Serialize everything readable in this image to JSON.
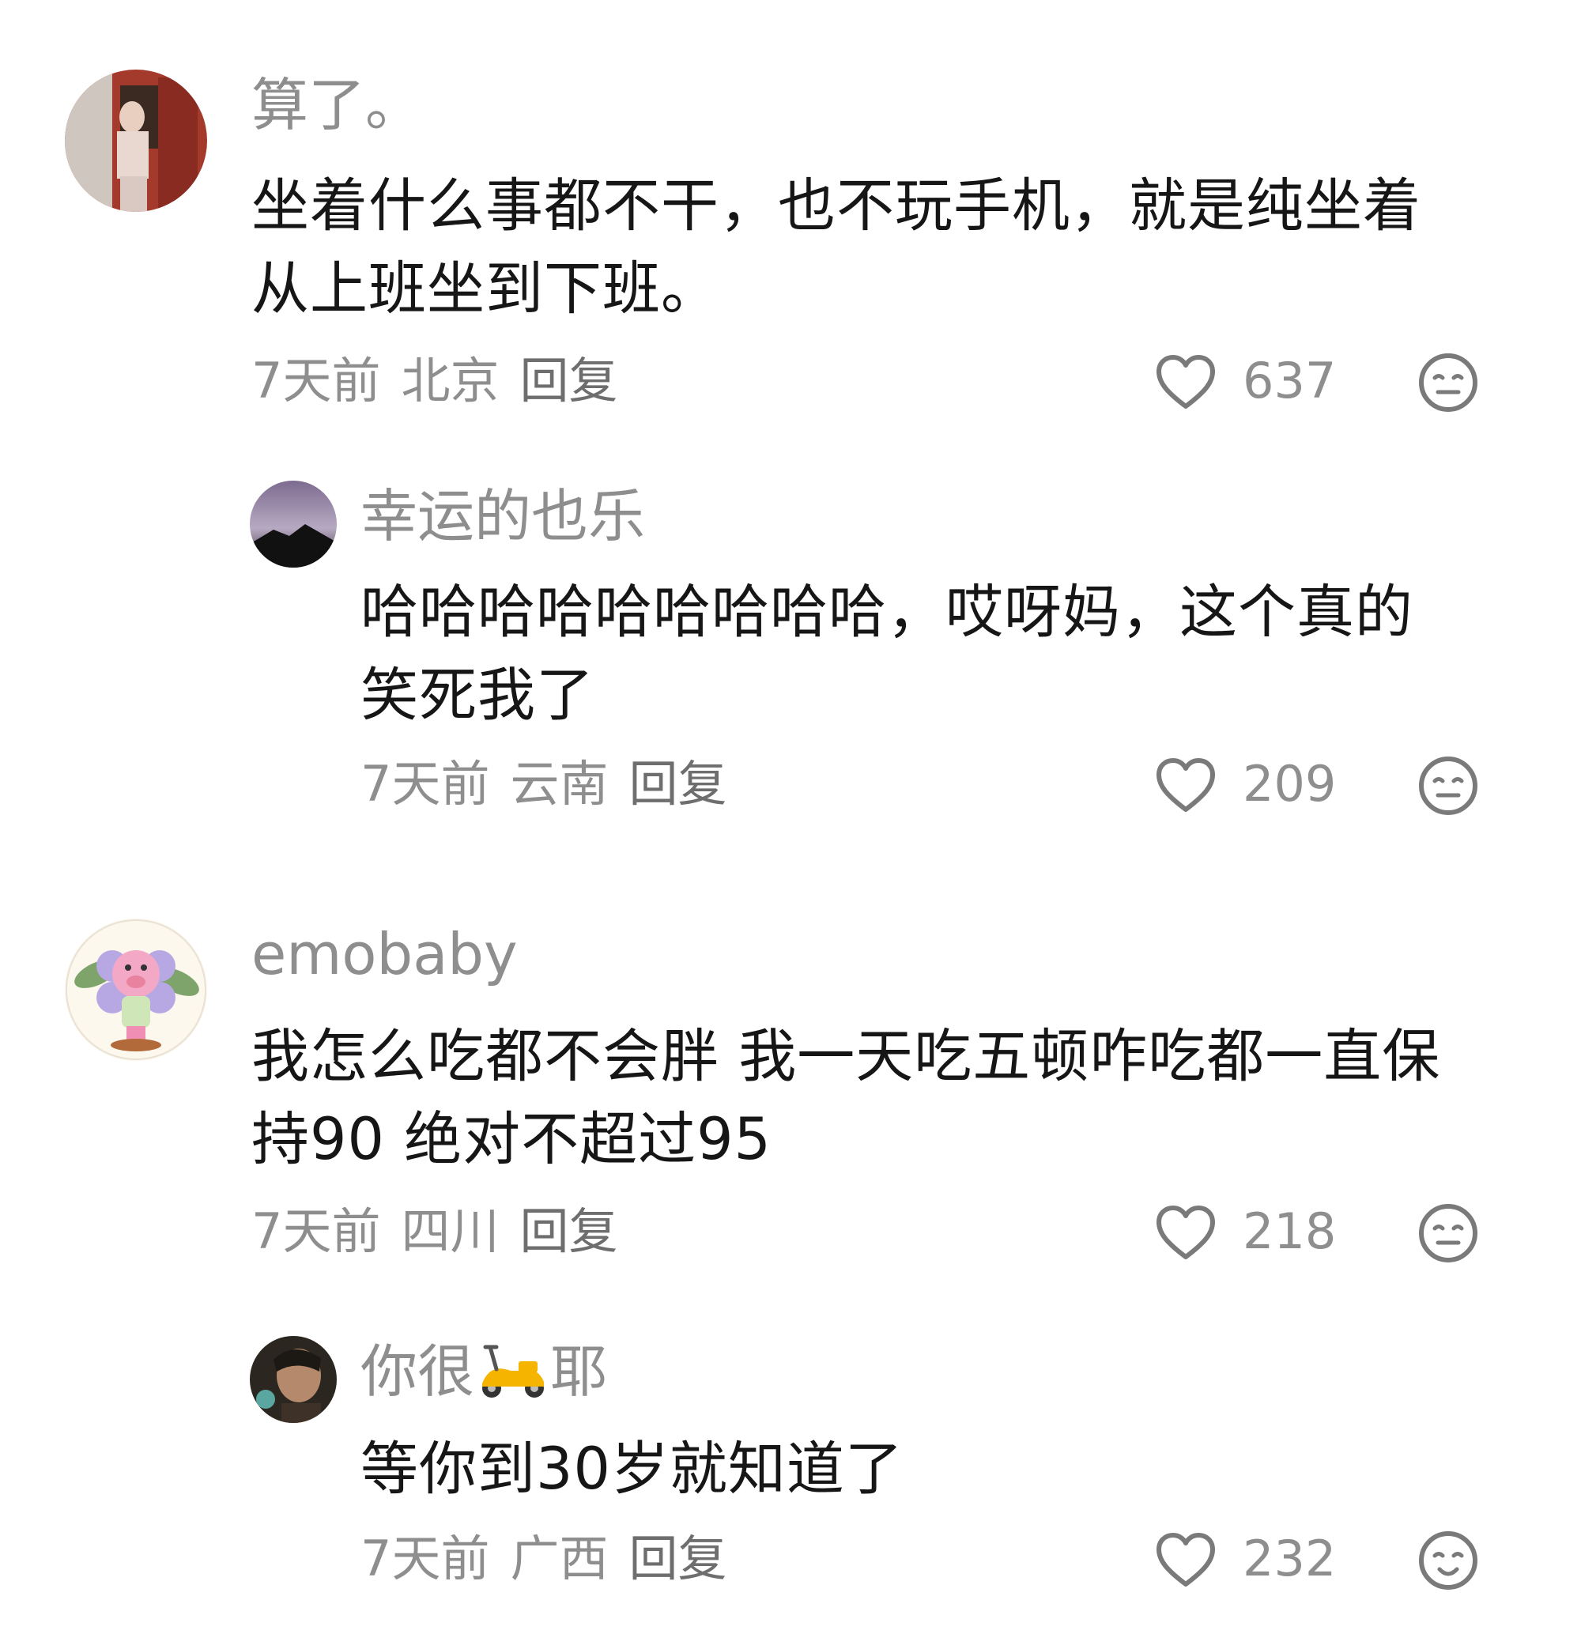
{
  "comments": [
    {
      "nickname": "算了。",
      "lines": [
        "坐着什么事都不干，也不玩手机，就是纯坐着",
        "从上班坐到下班。"
      ],
      "time": "7天前",
      "location": "北京",
      "reply_label": "回复",
      "likes": "637"
    },
    {
      "nickname": "幸运的也乐",
      "lines": [
        "哈哈哈哈哈哈哈哈哈，哎呀妈，这个真的",
        "笑死我了"
      ],
      "time": "7天前",
      "location": "云南",
      "reply_label": "回复",
      "likes": "209"
    },
    {
      "nickname": "emobaby",
      "lines": [
        "我怎么吃都不会胖  我一天吃五顿咋吃都一直保",
        "持90  绝对不超过95"
      ],
      "time": "7天前",
      "location": "四川",
      "reply_label": "回复",
      "likes": "218"
    },
    {
      "nickname_before": "你很",
      "nickname_after": "耶",
      "lines": [
        "等你到30岁就知道了"
      ],
      "time": "7天前",
      "location": "广西",
      "reply_label": "回复",
      "likes": "232"
    }
  ],
  "icons": {
    "like": "heart-outline-icon",
    "reaction": "face-icon",
    "nickname_emoji": "scooter-emoji-icon"
  },
  "colors": {
    "secondary_text": "#8e8e8e",
    "primary_text": "#161616",
    "icon_stroke": "#7a7a7a"
  }
}
